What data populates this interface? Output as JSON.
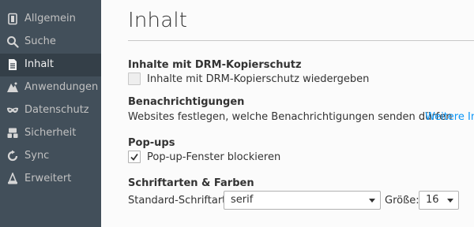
{
  "sidebar": {
    "items": [
      {
        "label": "Allgemein",
        "icon": "general-icon",
        "active": false
      },
      {
        "label": "Suche",
        "icon": "search-icon",
        "active": false
      },
      {
        "label": "Inhalt",
        "icon": "content-icon",
        "active": true
      },
      {
        "label": "Anwendungen",
        "icon": "applications-icon",
        "active": false
      },
      {
        "label": "Datenschutz",
        "icon": "privacy-mask-icon",
        "active": false
      },
      {
        "label": "Sicherheit",
        "icon": "security-icon",
        "active": false
      },
      {
        "label": "Sync",
        "icon": "sync-icon",
        "active": false
      },
      {
        "label": "Erweitert",
        "icon": "advanced-icon",
        "active": false
      }
    ]
  },
  "main": {
    "title": "Inhalt",
    "drm": {
      "heading": "Inhalte mit DRM-Kopierschutz",
      "checkbox_label": "Inhalte mit DRM-Kopierschutz wiedergeben",
      "checked": false
    },
    "notifications": {
      "heading": "Benachrichtigungen",
      "description": "Websites festlegen, welche Benachrichtigungen senden dürfen",
      "link": "Weitere Inf"
    },
    "popups": {
      "heading": "Pop-ups",
      "checkbox_label": "Pop-up-Fenster blockieren",
      "checked": true
    },
    "fonts": {
      "heading": "Schriftarten & Farben",
      "default_font_label": "Standard-Schriftart:",
      "default_font_value": "serif",
      "size_label": "Größe:",
      "size_value": "16"
    }
  },
  "colors": {
    "sidebar_bg": "#424f5a",
    "sidebar_active_bg": "#343f48",
    "link": "#0996f8"
  }
}
